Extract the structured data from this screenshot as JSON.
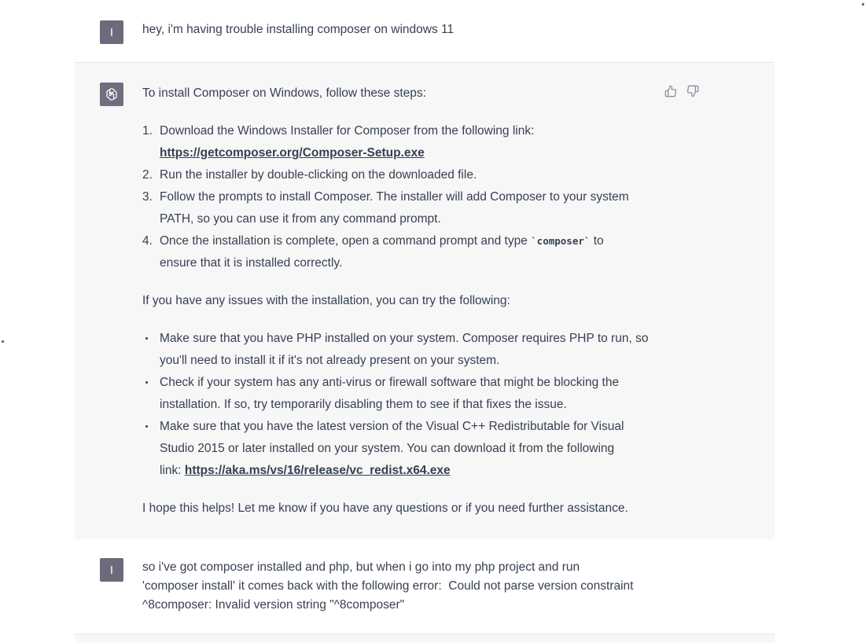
{
  "messages": [
    {
      "role": "user",
      "avatar": "I",
      "text": "hey, i'm having trouble installing composer on windows 11"
    },
    {
      "role": "assistant",
      "intro": "To install Composer on Windows, follow these steps:",
      "steps": [
        {
          "num": "1.",
          "text_line1": "Download the Windows Installer for Composer from the following link:",
          "link": "https://getcomposer.org/Composer-Setup.exe"
        },
        {
          "num": "2.",
          "text": "Run the installer by double-clicking on the downloaded file."
        },
        {
          "num": "3.",
          "text_line1": "Follow the prompts to install Composer. The installer will add Composer to your system",
          "text_line2": "PATH, so you can use it from any command prompt."
        },
        {
          "num": "4.",
          "text_before": "Once the installation is complete, open a command prompt and type ",
          "code": "`composer`",
          "text_after": " to",
          "text_line2": "ensure that it is installed correctly."
        }
      ],
      "troubleshoot_intro": "If you have any issues with the installation, you can try the following:",
      "bullets": [
        {
          "text_line1": "Make sure that you have PHP installed on your system. Composer requires PHP to run, so",
          "text_line2": "you'll need to install it if it's not already present on your system."
        },
        {
          "text_line1": "Check if your system has any anti-virus or firewall software that might be blocking the",
          "text_line2": "installation. If so, try temporarily disabling them to see if that fixes the issue."
        },
        {
          "text_line1": "Make sure that you have the latest version of the Visual C++ Redistributable for Visual",
          "text_line2": "Studio 2015 or later installed on your system. You can download it from the following",
          "link_prefix": "link: ",
          "link": "https://aka.ms/vs/16/release/vc_redist.x64.exe"
        }
      ],
      "closing": "I hope this helps! Let me know if you have any questions or if you need further assistance.",
      "icons": {
        "thumbs_up": "thumbs-up-icon",
        "thumbs_down": "thumbs-down-icon"
      }
    },
    {
      "role": "user",
      "avatar": "I",
      "line1": "so i've got composer installed and php, but when i go into my php project and run",
      "line2": "'composer install' it comes back with the following error:  Could not parse version constraint",
      "line3": "^8composer: Invalid version string \"^8composer\""
    }
  ],
  "colors": {
    "assistant_bg": "#f7f7f8",
    "user_avatar": "#6b6b7b",
    "assistant_avatar": "#6e6e80",
    "text": "#374151"
  }
}
